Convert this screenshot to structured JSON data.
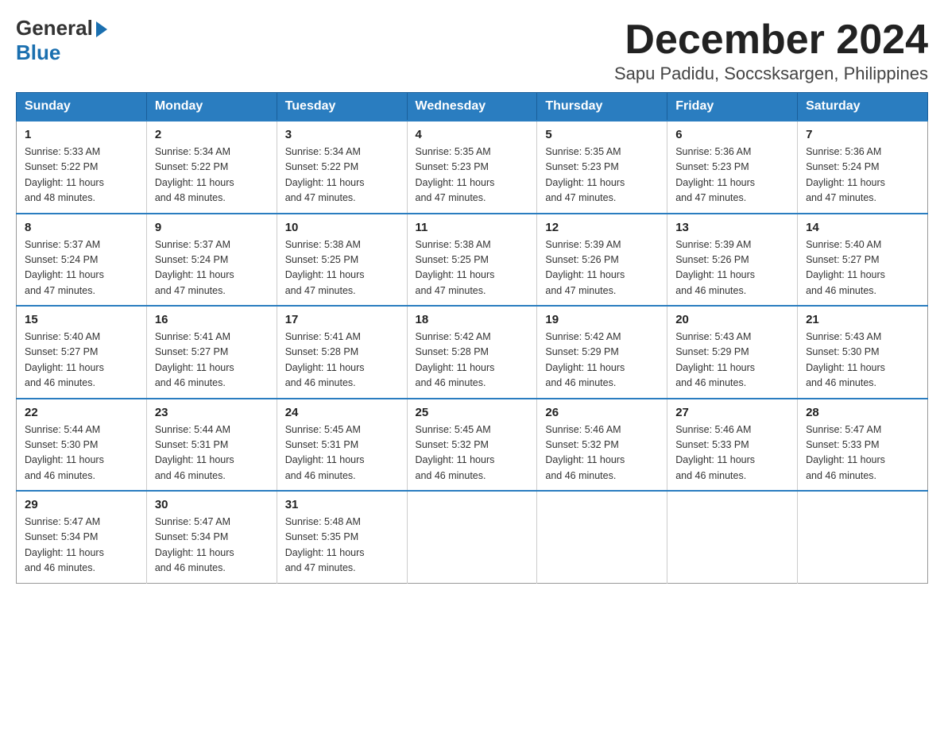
{
  "logo": {
    "general": "General",
    "blue": "Blue"
  },
  "header": {
    "month": "December 2024",
    "location": "Sapu Padidu, Soccsksargen, Philippines"
  },
  "weekdays": [
    "Sunday",
    "Monday",
    "Tuesday",
    "Wednesday",
    "Thursday",
    "Friday",
    "Saturday"
  ],
  "weeks": [
    [
      {
        "day": "1",
        "sunrise": "5:33 AM",
        "sunset": "5:22 PM",
        "daylight": "11 hours and 48 minutes."
      },
      {
        "day": "2",
        "sunrise": "5:34 AM",
        "sunset": "5:22 PM",
        "daylight": "11 hours and 48 minutes."
      },
      {
        "day": "3",
        "sunrise": "5:34 AM",
        "sunset": "5:22 PM",
        "daylight": "11 hours and 47 minutes."
      },
      {
        "day": "4",
        "sunrise": "5:35 AM",
        "sunset": "5:23 PM",
        "daylight": "11 hours and 47 minutes."
      },
      {
        "day": "5",
        "sunrise": "5:35 AM",
        "sunset": "5:23 PM",
        "daylight": "11 hours and 47 minutes."
      },
      {
        "day": "6",
        "sunrise": "5:36 AM",
        "sunset": "5:23 PM",
        "daylight": "11 hours and 47 minutes."
      },
      {
        "day": "7",
        "sunrise": "5:36 AM",
        "sunset": "5:24 PM",
        "daylight": "11 hours and 47 minutes."
      }
    ],
    [
      {
        "day": "8",
        "sunrise": "5:37 AM",
        "sunset": "5:24 PM",
        "daylight": "11 hours and 47 minutes."
      },
      {
        "day": "9",
        "sunrise": "5:37 AM",
        "sunset": "5:24 PM",
        "daylight": "11 hours and 47 minutes."
      },
      {
        "day": "10",
        "sunrise": "5:38 AM",
        "sunset": "5:25 PM",
        "daylight": "11 hours and 47 minutes."
      },
      {
        "day": "11",
        "sunrise": "5:38 AM",
        "sunset": "5:25 PM",
        "daylight": "11 hours and 47 minutes."
      },
      {
        "day": "12",
        "sunrise": "5:39 AM",
        "sunset": "5:26 PM",
        "daylight": "11 hours and 47 minutes."
      },
      {
        "day": "13",
        "sunrise": "5:39 AM",
        "sunset": "5:26 PM",
        "daylight": "11 hours and 46 minutes."
      },
      {
        "day": "14",
        "sunrise": "5:40 AM",
        "sunset": "5:27 PM",
        "daylight": "11 hours and 46 minutes."
      }
    ],
    [
      {
        "day": "15",
        "sunrise": "5:40 AM",
        "sunset": "5:27 PM",
        "daylight": "11 hours and 46 minutes."
      },
      {
        "day": "16",
        "sunrise": "5:41 AM",
        "sunset": "5:27 PM",
        "daylight": "11 hours and 46 minutes."
      },
      {
        "day": "17",
        "sunrise": "5:41 AM",
        "sunset": "5:28 PM",
        "daylight": "11 hours and 46 minutes."
      },
      {
        "day": "18",
        "sunrise": "5:42 AM",
        "sunset": "5:28 PM",
        "daylight": "11 hours and 46 minutes."
      },
      {
        "day": "19",
        "sunrise": "5:42 AM",
        "sunset": "5:29 PM",
        "daylight": "11 hours and 46 minutes."
      },
      {
        "day": "20",
        "sunrise": "5:43 AM",
        "sunset": "5:29 PM",
        "daylight": "11 hours and 46 minutes."
      },
      {
        "day": "21",
        "sunrise": "5:43 AM",
        "sunset": "5:30 PM",
        "daylight": "11 hours and 46 minutes."
      }
    ],
    [
      {
        "day": "22",
        "sunrise": "5:44 AM",
        "sunset": "5:30 PM",
        "daylight": "11 hours and 46 minutes."
      },
      {
        "day": "23",
        "sunrise": "5:44 AM",
        "sunset": "5:31 PM",
        "daylight": "11 hours and 46 minutes."
      },
      {
        "day": "24",
        "sunrise": "5:45 AM",
        "sunset": "5:31 PM",
        "daylight": "11 hours and 46 minutes."
      },
      {
        "day": "25",
        "sunrise": "5:45 AM",
        "sunset": "5:32 PM",
        "daylight": "11 hours and 46 minutes."
      },
      {
        "day": "26",
        "sunrise": "5:46 AM",
        "sunset": "5:32 PM",
        "daylight": "11 hours and 46 minutes."
      },
      {
        "day": "27",
        "sunrise": "5:46 AM",
        "sunset": "5:33 PM",
        "daylight": "11 hours and 46 minutes."
      },
      {
        "day": "28",
        "sunrise": "5:47 AM",
        "sunset": "5:33 PM",
        "daylight": "11 hours and 46 minutes."
      }
    ],
    [
      {
        "day": "29",
        "sunrise": "5:47 AM",
        "sunset": "5:34 PM",
        "daylight": "11 hours and 46 minutes."
      },
      {
        "day": "30",
        "sunrise": "5:47 AM",
        "sunset": "5:34 PM",
        "daylight": "11 hours and 46 minutes."
      },
      {
        "day": "31",
        "sunrise": "5:48 AM",
        "sunset": "5:35 PM",
        "daylight": "11 hours and 47 minutes."
      },
      null,
      null,
      null,
      null
    ]
  ],
  "labels": {
    "sunrise": "Sunrise:",
    "sunset": "Sunset:",
    "daylight": "Daylight:"
  }
}
